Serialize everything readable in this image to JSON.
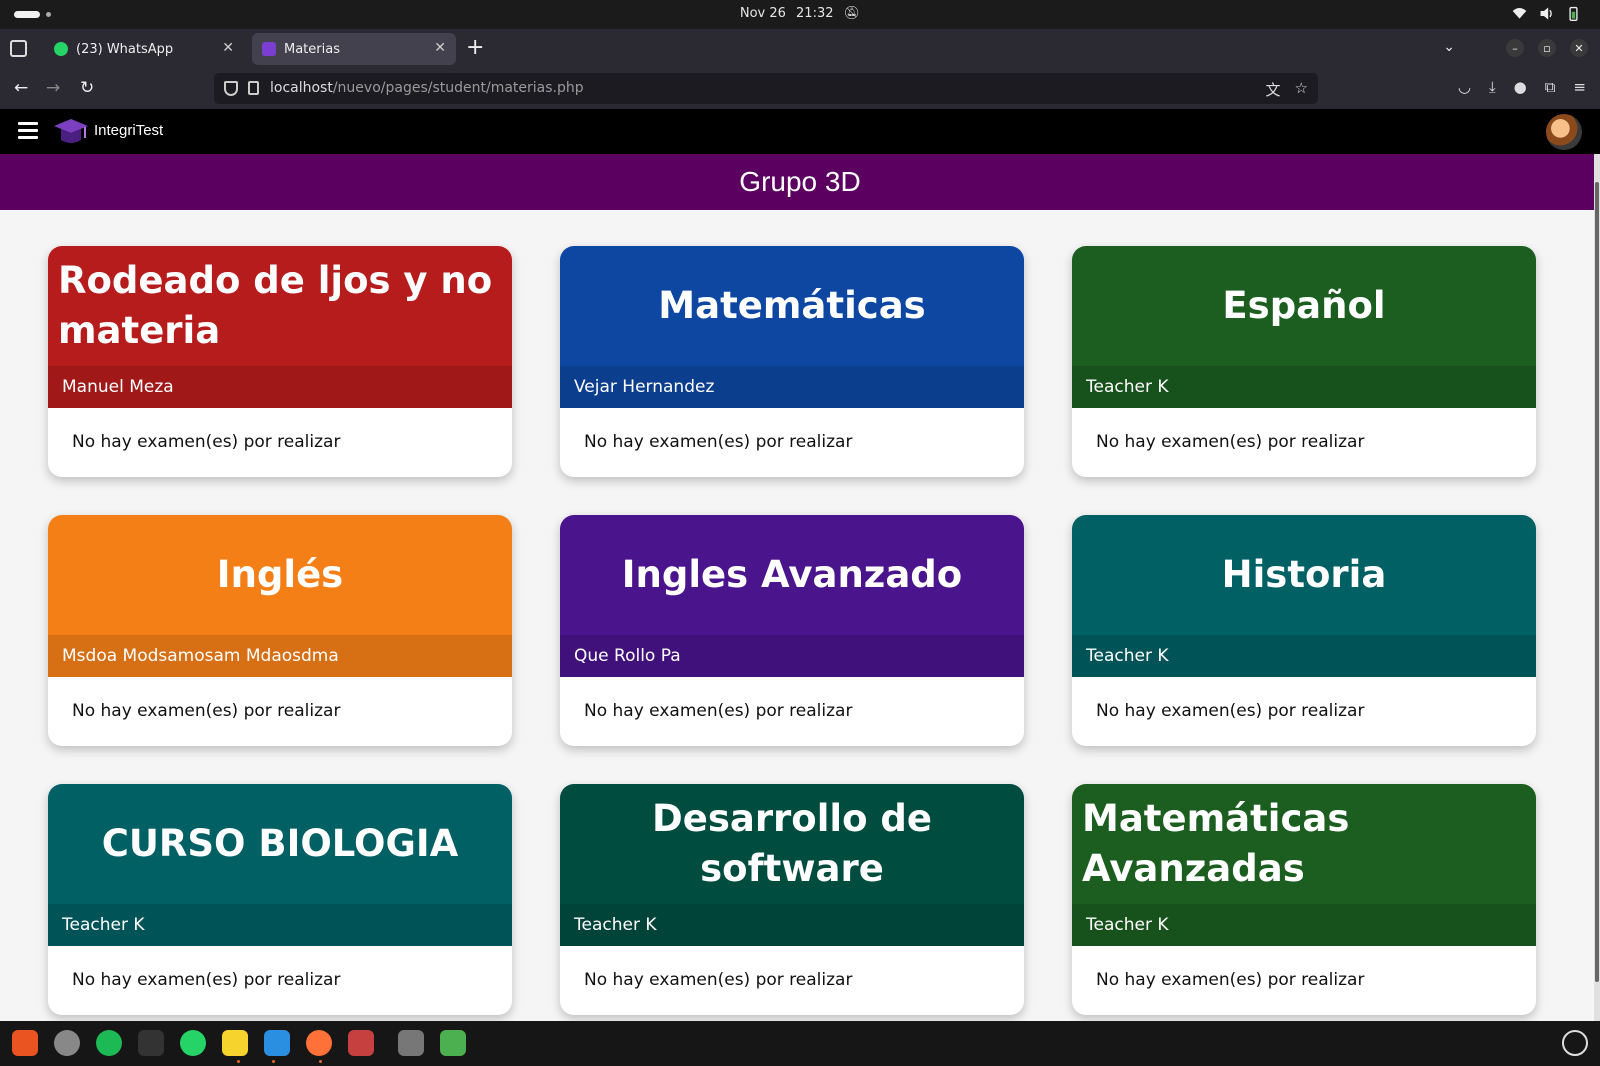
{
  "system": {
    "date": "Nov 26",
    "time": "21:32"
  },
  "browser": {
    "tabs": [
      {
        "label": "(23) WhatsApp",
        "active": false,
        "favicon_color": "#25d366"
      },
      {
        "label": "Materias",
        "active": true,
        "favicon_color": "#7a3fd0"
      }
    ],
    "url_host": "localhost",
    "url_path": "/nuevo/pages/student/materias.php"
  },
  "app": {
    "brand": "IntegriTest"
  },
  "group": {
    "title": "Grupo 3D"
  },
  "subjects": [
    {
      "title": "Rodeado de ljos y no materia",
      "teacher": "Manuel Meza",
      "status": "No hay examen(es) por realizar",
      "color": "#b71c1c"
    },
    {
      "title": "Matemáticas",
      "teacher": "Vejar Hernandez",
      "status": "No hay examen(es) por realizar",
      "color": "#0d47a1"
    },
    {
      "title": "Español",
      "teacher": "Teacher K",
      "status": "No hay examen(es) por realizar",
      "color": "#1b5e20"
    },
    {
      "title": "Inglés",
      "teacher": "Msdoa Modsamosam Mdaosdma",
      "status": "No hay examen(es) por realizar",
      "color": "#f57f17"
    },
    {
      "title": "Ingles Avanzado",
      "teacher": "Que Rollo Pa",
      "status": "No hay examen(es) por realizar",
      "color": "#4a148c"
    },
    {
      "title": "Historia",
      "teacher": "Teacher K",
      "status": "No hay examen(es) por realizar",
      "color": "#006064"
    },
    {
      "title": "CURSO BIOLOGIA",
      "teacher": "Teacher K",
      "status": "No hay examen(es) por realizar",
      "color": "#006064"
    },
    {
      "title": "Desarrollo de software",
      "teacher": "Teacher K",
      "status": "No hay examen(es) por realizar",
      "color": "#004d40"
    },
    {
      "title": "Matemáticas Avanzadas",
      "teacher": "Teacher K",
      "status": "No hay examen(es) por realizar",
      "color": "#1b5e20"
    }
  ],
  "dock": [
    {
      "name": "app-center-icon",
      "color": "#e95420"
    },
    {
      "name": "settings-icon",
      "color": "#888888"
    },
    {
      "name": "spotify-icon",
      "color": "#1db954"
    },
    {
      "name": "terminal-icon",
      "color": "#333333"
    },
    {
      "name": "whatsapp-icon",
      "color": "#25d366"
    },
    {
      "name": "text-editor-icon",
      "color": "#f6d32d"
    },
    {
      "name": "vscode-icon",
      "color": "#2a8fe0"
    },
    {
      "name": "firefox-icon",
      "color": "#ff7139"
    },
    {
      "name": "files-icon",
      "color": "#c64040"
    },
    {
      "name": "disk-icon",
      "color": "#777777"
    },
    {
      "name": "trash-icon",
      "color": "#4caf50"
    }
  ]
}
